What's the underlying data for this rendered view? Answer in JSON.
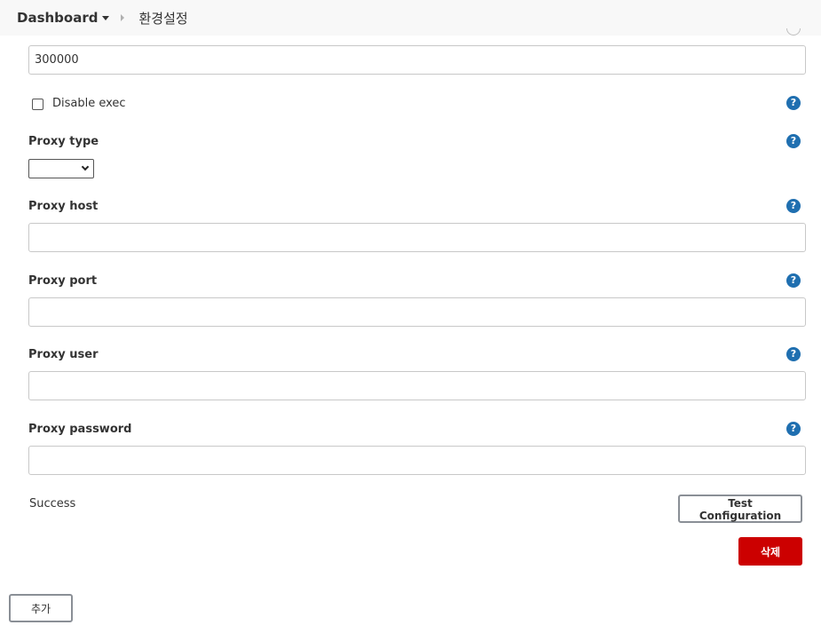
{
  "breadcrumb": {
    "root": "Dashboard",
    "current": "환경설정"
  },
  "fields": {
    "timeout_value": "300000",
    "disable_exec_label": "Disable exec",
    "proxy_type_label": "Proxy type",
    "proxy_type_value": "",
    "proxy_host_label": "Proxy host",
    "proxy_host_value": "",
    "proxy_port_label": "Proxy port",
    "proxy_port_value": "",
    "proxy_user_label": "Proxy user",
    "proxy_user_value": "",
    "proxy_password_label": "Proxy password",
    "proxy_password_value": ""
  },
  "help_icon_glyph": "?",
  "status": "Success",
  "buttons": {
    "test_configuration": "Test Configuration",
    "delete": "삭제",
    "add": "추가"
  },
  "colors": {
    "help": "#1f6fb0",
    "danger": "#cc0000",
    "header_bg": "#f8f8f8"
  },
  "icons": {
    "dropdown": "caret-down-icon",
    "separator": "chevron-right-icon",
    "help": "help-icon"
  }
}
